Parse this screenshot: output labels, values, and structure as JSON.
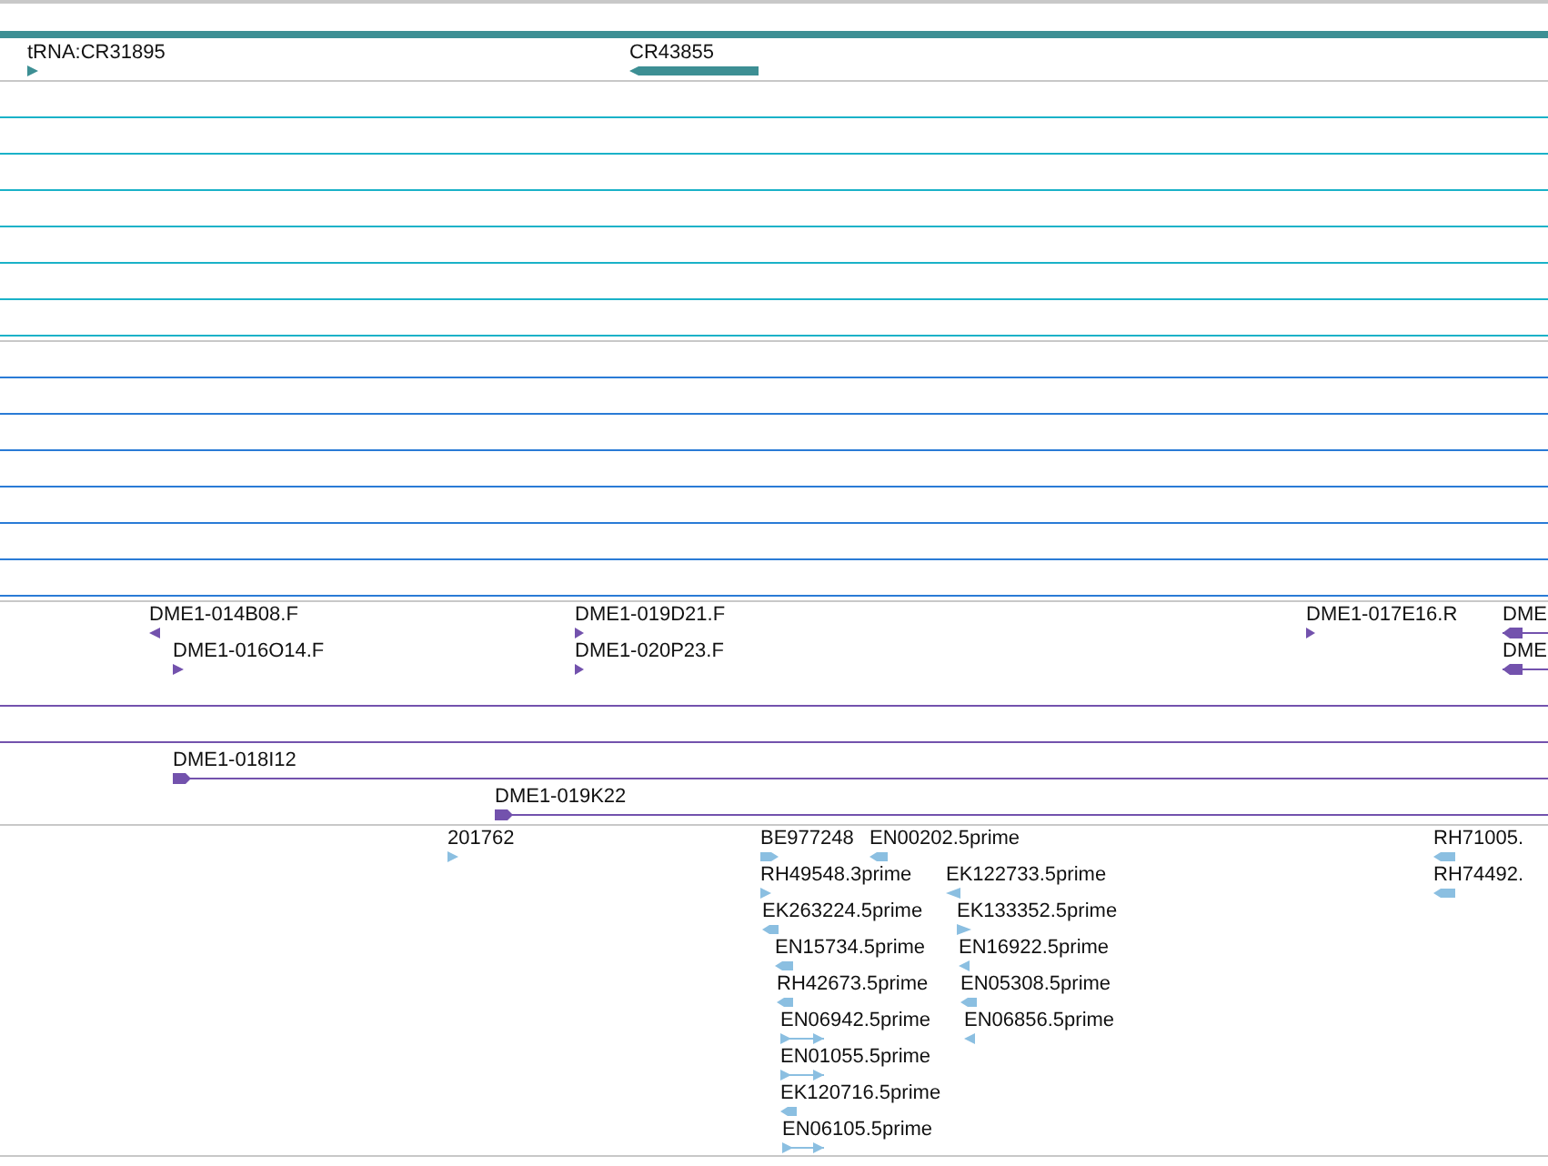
{
  "tracks": [
    {
      "kind": "features",
      "color": "#3d8f94",
      "features": [
        {
          "kind": "band"
        },
        {
          "label": "tRNA:CR31895",
          "kind": "point",
          "reverse": false
        },
        {
          "label": "CR43855",
          "kind": "bar",
          "reverse": true
        }
      ]
    },
    {
      "kind": "empty",
      "color": "#1ab2c8"
    },
    {
      "kind": "empty",
      "color": "#2a7bd6"
    },
    {
      "kind": "features",
      "color": "#7352ad",
      "features": [
        {
          "label": "DME1-014B08.F",
          "kind": "point",
          "reverse": true
        },
        {
          "label": "DME1-016O14.F",
          "kind": "point",
          "reverse": false
        },
        {
          "label": "DME1-019D21.F",
          "kind": "point",
          "reverse": false
        },
        {
          "label": "DME1-020P23.F",
          "kind": "point",
          "reverse": false
        },
        {
          "label": "DME1-017E16.R",
          "kind": "point",
          "reverse": false
        },
        {
          "label": "DME",
          "kind": "span",
          "reverse": true
        },
        {
          "label": "DME",
          "kind": "span",
          "reverse": true
        },
        {
          "kind": "line"
        },
        {
          "kind": "line"
        },
        {
          "label": "DME1-018I12",
          "kind": "span",
          "reverse": false
        },
        {
          "label": "DME1-019K22",
          "kind": "span",
          "reverse": false
        }
      ]
    },
    {
      "kind": "features",
      "color": "#8bbfe1",
      "features": [
        {
          "label": "201762",
          "kind": "point",
          "reverse": false
        },
        {
          "label": "BE977248",
          "kind": "block",
          "reverse": false
        },
        {
          "label": "EN00202.5prime",
          "kind": "block",
          "reverse": true
        },
        {
          "label": "RH49548.3prime",
          "kind": "point",
          "reverse": false
        },
        {
          "label": "EK122733.5prime",
          "kind": "point",
          "reverse": true
        },
        {
          "label": "EK263224.5prime",
          "kind": "block",
          "reverse": true
        },
        {
          "label": "EK133352.5prime",
          "kind": "point",
          "reverse": false
        },
        {
          "label": "EN15734.5prime",
          "kind": "block",
          "reverse": true
        },
        {
          "label": "EN16922.5prime",
          "kind": "point",
          "reverse": true
        },
        {
          "label": "RH42673.5prime",
          "kind": "block",
          "reverse": true
        },
        {
          "label": "EN05308.5prime",
          "kind": "block",
          "reverse": true
        },
        {
          "label": "EN06942.5prime",
          "kind": "linked",
          "reverse": false
        },
        {
          "label": "EN06856.5prime",
          "kind": "point",
          "reverse": true
        },
        {
          "label": "EN01055.5prime",
          "kind": "linked",
          "reverse": false
        },
        {
          "label": "EK120716.5prime",
          "kind": "block",
          "reverse": true
        },
        {
          "label": "EN06105.5prime",
          "kind": "linked",
          "reverse": false
        },
        {
          "label": "RH71005.",
          "kind": "block",
          "reverse": true
        },
        {
          "label": "RH74492.",
          "kind": "block",
          "reverse": true
        }
      ]
    }
  ]
}
